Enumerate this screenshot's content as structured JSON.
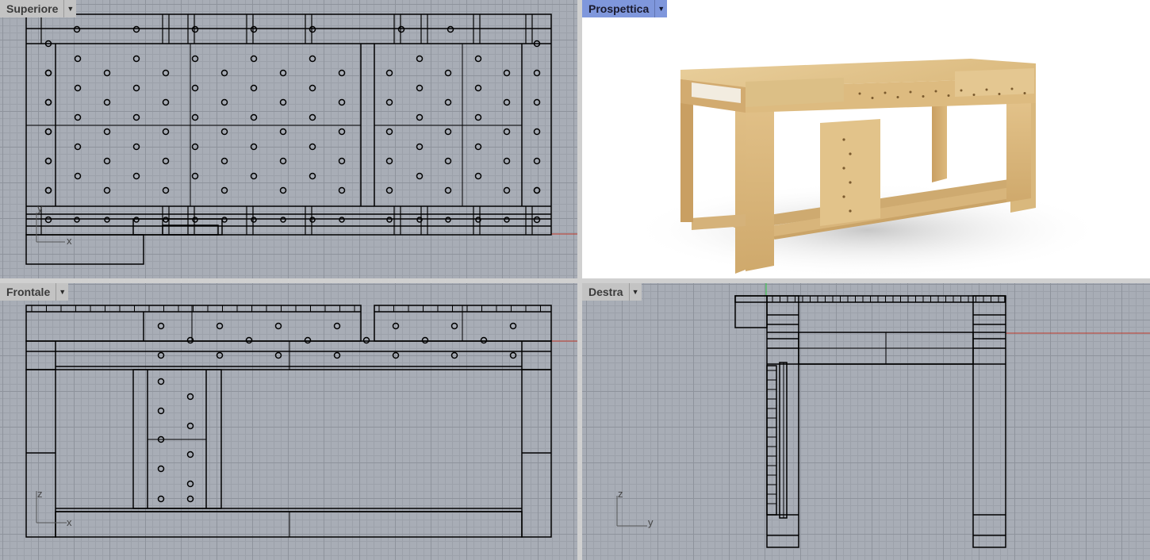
{
  "viewports": {
    "top": {
      "title": "Superiore",
      "axis_h": "x",
      "axis_v": "y",
      "active": false
    },
    "perspective": {
      "title": "Prospettica",
      "active": true
    },
    "front": {
      "title": "Frontale",
      "axis_h": "x",
      "axis_v": "z",
      "active": false
    },
    "right": {
      "title": "Destra",
      "axis_h": "y",
      "axis_v": "z",
      "active": false
    }
  },
  "icons": {
    "viewport_menu": "chevron-down-icon"
  },
  "colors": {
    "grid_background": "#a8adb6",
    "active_tab": "#7f97dc",
    "inactive_tab": "#c3c3c3",
    "x_axis": "#c0392b",
    "y_axis": "#2ecc40",
    "wood": "#e3c48c",
    "wireframe": "#000000"
  }
}
